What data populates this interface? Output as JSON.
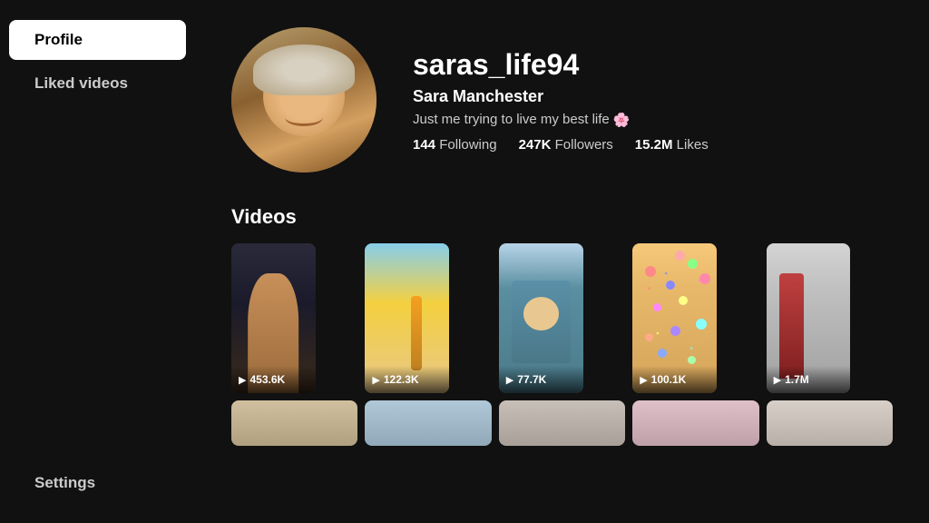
{
  "sidebar": {
    "items": [
      {
        "id": "profile",
        "label": "Profile",
        "active": true
      },
      {
        "id": "liked-videos",
        "label": "Liked videos",
        "active": false
      }
    ],
    "bottom_items": [
      {
        "id": "settings",
        "label": "Settings"
      }
    ]
  },
  "profile": {
    "username": "saras_life94",
    "display_name": "Sara Manchester",
    "bio": "Just me trying to live my best life",
    "bio_emoji": "🌸",
    "stats": {
      "following": {
        "value": "144",
        "label": "Following"
      },
      "followers": {
        "value": "247K",
        "label": "Followers"
      },
      "likes": {
        "value": "15.2M",
        "label": "Likes"
      }
    }
  },
  "videos_section": {
    "title": "Videos",
    "items": [
      {
        "views": "453.6K",
        "bg": "dark-portrait"
      },
      {
        "views": "122.3K",
        "bg": "beach-volleyball"
      },
      {
        "views": "77.7K",
        "bg": "indoor-selfie"
      },
      {
        "views": "100.1K",
        "bg": "crowd-dots"
      },
      {
        "views": "1.7M",
        "bg": "office-scene"
      }
    ]
  }
}
